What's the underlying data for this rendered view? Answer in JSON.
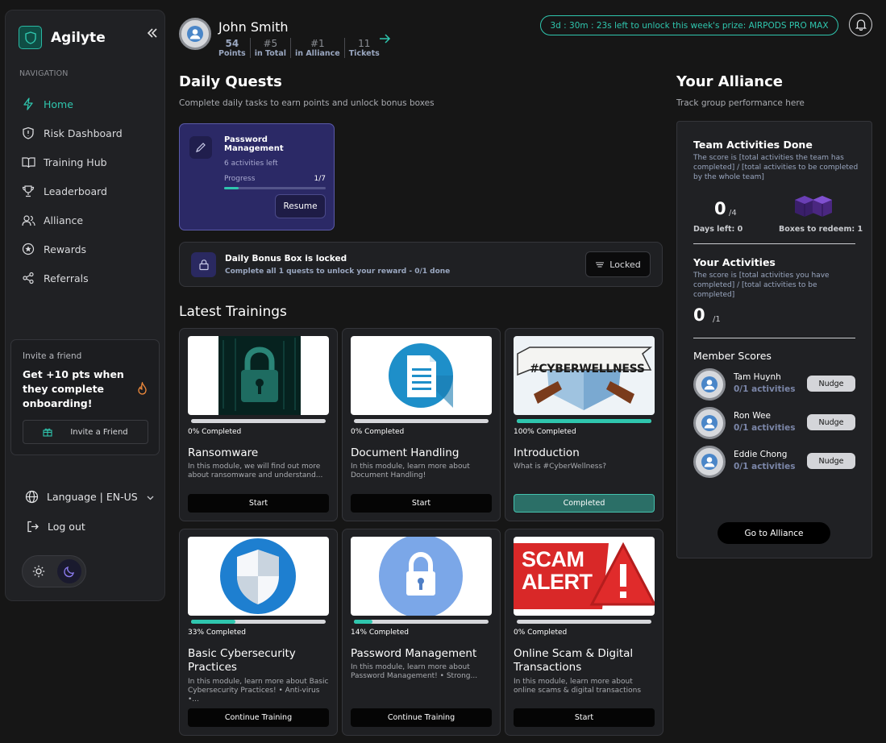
{
  "brand": {
    "name": "Agilyte"
  },
  "nav": {
    "label": "NAVIGATION",
    "items": [
      {
        "label": "Home",
        "icon": "bolt-icon",
        "active": true
      },
      {
        "label": "Risk Dashboard",
        "icon": "shield-icon"
      },
      {
        "label": "Training Hub",
        "icon": "book-icon"
      },
      {
        "label": "Leaderboard",
        "icon": "trophy-icon"
      },
      {
        "label": "Alliance",
        "icon": "users-icon"
      },
      {
        "label": "Rewards",
        "icon": "star-icon"
      },
      {
        "label": "Referrals",
        "icon": "share-icon"
      }
    ]
  },
  "invite": {
    "label": "Invite a friend",
    "text": "Get +10 pts when they complete onboarding!",
    "button": "Invite a Friend"
  },
  "language": {
    "label": "Language | EN-US"
  },
  "logout": {
    "label": "Log out"
  },
  "profile": {
    "name": "John Smith",
    "stats": [
      {
        "value": "54",
        "label": "Points"
      },
      {
        "value": "#5",
        "label": "in Total"
      },
      {
        "value": "#1",
        "label": "in Alliance"
      },
      {
        "value": "11",
        "label": "Tickets"
      }
    ]
  },
  "prize_banner": "3d : 30m : 23s left to unlock this week's prize: AIRPODS PRO MAX",
  "quests": {
    "title": "Daily Quests",
    "subtitle": "Complete daily tasks to earn points and unlock bonus boxes",
    "card": {
      "title": "Password Management",
      "activities_left": "6 activities left",
      "progress_label": "Progress",
      "progress_count": "1/7",
      "progress": 0.14,
      "button": "Resume"
    },
    "bonus": {
      "title": "Daily Bonus Box is locked",
      "subtitle": "Complete all 1 quests to unlock your reward - 0/1 done",
      "button": "Locked"
    }
  },
  "trainings": {
    "title": "Latest Trainings",
    "items": [
      {
        "title": "Ransomware",
        "pct_label": "0% Completed",
        "progress": 0,
        "desc": "In this module, we will find out more about ransomware and understand...",
        "button": "Start",
        "image": "ransomware-lock-image"
      },
      {
        "title": "Document Handling",
        "pct_label": "0% Completed",
        "progress": 0,
        "desc": "In this module, learn more about Document Handling!",
        "button": "Start",
        "image": "document-image"
      },
      {
        "title": "Introduction",
        "pct_label": "100% Completed",
        "progress": 1,
        "desc": "What is #CyberWellness?",
        "button": "Completed",
        "image": "cyberwellness-banner-image",
        "banner_text": "#CYBERWELLNESS"
      },
      {
        "title": "Basic Cybersecurity Practices",
        "pct_label": "33% Completed",
        "progress": 0.33,
        "desc": "In this module, learn more about Basic Cybersecurity Practices! • Anti-virus •...",
        "button": "Continue Training",
        "image": "shield-image"
      },
      {
        "title": "Password Management",
        "pct_label": "14% Completed",
        "progress": 0.14,
        "desc": "In this module, learn more about Password Management! • Strong...",
        "button": "Continue Training",
        "image": "padlock-image"
      },
      {
        "title": "Online Scam & Digital Transactions",
        "pct_label": "0% Completed",
        "progress": 0,
        "desc": "In this module, learn more about online scams & digital transactions",
        "button": "Start",
        "image": "scam-alert-image",
        "banner_text": "SCAM ALERT"
      }
    ]
  },
  "alliance": {
    "title": "Your Alliance",
    "subtitle": "Track group performance here",
    "team": {
      "title": "Team Activities Done",
      "desc": "The score is [total activities the team has completed] / [total activities to be completed by the whole team]",
      "score": "0",
      "total": "/4",
      "days_left": "Days left: 0",
      "boxes": "Boxes to redeem: 1"
    },
    "yours": {
      "title": "Your Activities",
      "desc": "The score is [total activities you have completed] / [total activities to be completed]",
      "score": "0",
      "total": "/1"
    },
    "members_title": "Member Scores",
    "members": [
      {
        "name": "Tam Huynh",
        "activities": "0/1 activities",
        "button": "Nudge"
      },
      {
        "name": "Ron Wee",
        "activities": "0/1 activities",
        "button": "Nudge"
      },
      {
        "name": "Eddie Chong",
        "activities": "0/1 activities",
        "button": "Nudge"
      }
    ],
    "button": "Go to Alliance"
  },
  "colors": {
    "accent": "#2fc6ae",
    "quest_card": "#2b2966",
    "background": "#161616",
    "panel": "#202124"
  }
}
